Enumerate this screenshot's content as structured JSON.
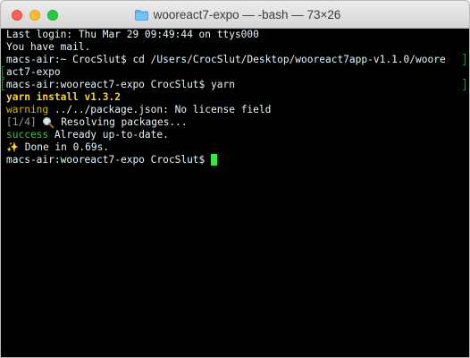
{
  "window": {
    "title": "wooreact7-expo — -bash — 73×26",
    "icon": "folder-icon"
  },
  "terminal": {
    "lines": [
      "Last login: Thu Mar 29 09:49:44 on ttys000",
      "You have mail.",
      "macs-air:~ CrocSlut$ cd /Users/CrocSlut/Desktop/wooreact7app-v1.1.0/woore",
      "act7-expo",
      "macs-air:wooreact7-expo CrocSlut$ yarn",
      "yarn install v1.3.2",
      "warning",
      " ../../package.json: No license field",
      "[1/4]",
      "Resolving packages...",
      "success",
      " Already up-to-date.",
      "Done in 0.69s.",
      "macs-air:wooreact7-expo CrocSlut$ "
    ],
    "icons": {
      "resolving": "magnifying-glass-icon",
      "done": "sparkles-icon"
    },
    "sparkle_glyph": "✨"
  },
  "colors": {
    "background": "#000000",
    "text": "#ffffff",
    "warning": "#d2b31e",
    "success": "#31c841",
    "cursor": "#31e845",
    "step": "#9a9a9a"
  }
}
